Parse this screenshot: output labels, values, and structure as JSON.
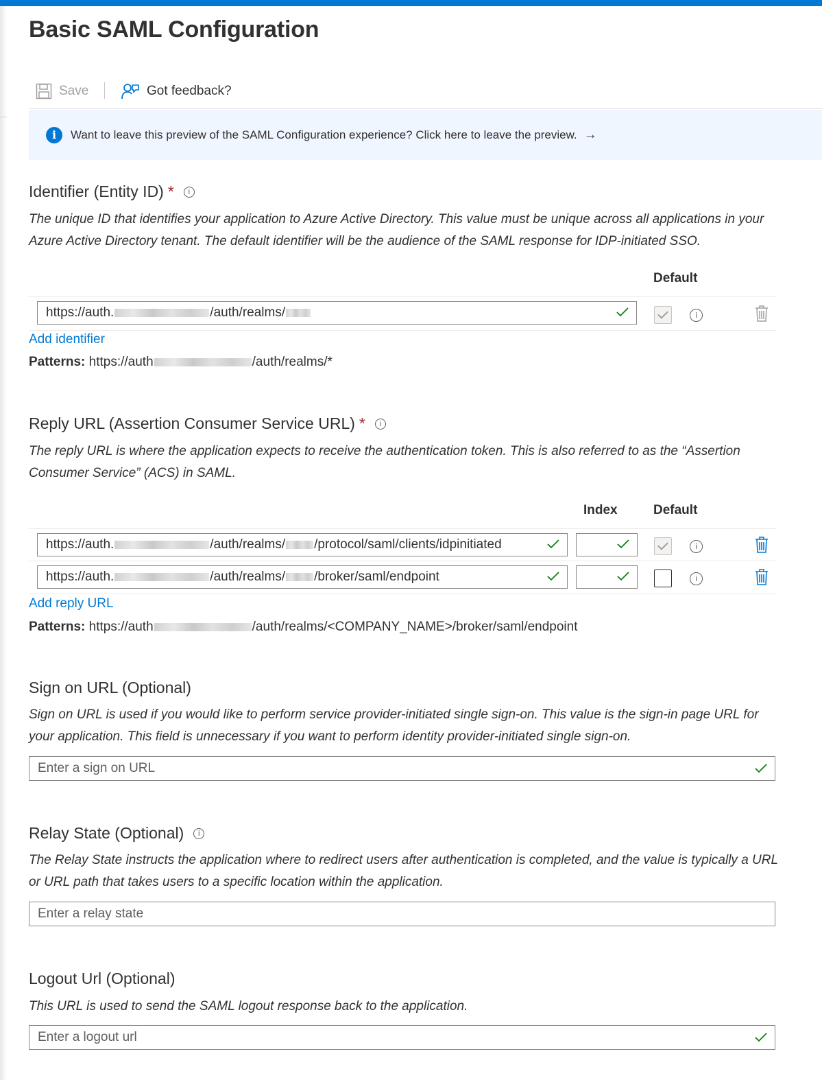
{
  "page": {
    "title": "Basic SAML Configuration"
  },
  "toolbar": {
    "save_label": "Save",
    "feedback_label": "Got feedback?"
  },
  "banner": {
    "text": "Want to leave this preview of the SAML Configuration experience? Click here to leave the preview.",
    "arrow": "→"
  },
  "identifier": {
    "heading": "Identifier (Entity ID)",
    "required_mark": "*",
    "description": "The unique ID that identifies your application to Azure Active Directory. This value must be unique across all applications in your Azure Active Directory tenant. The default identifier will be the audience of the SAML response for IDP-initiated SSO.",
    "col_default": "Default",
    "rows": [
      {
        "prefix": "https://auth.",
        "middle": "/auth/realms/",
        "suffix": "",
        "default_checked": true,
        "default_disabled": true
      }
    ],
    "add_link": "Add identifier",
    "patterns_label": "Patterns:",
    "patterns_prefix": "https://auth",
    "patterns_suffix": "/auth/realms/*"
  },
  "reply": {
    "heading": "Reply URL (Assertion Consumer Service URL)",
    "required_mark": "*",
    "description": "The reply URL is where the application expects to receive the authentication token. This is also referred to as the “Assertion Consumer Service” (ACS) in SAML.",
    "col_index": "Index",
    "col_default": "Default",
    "rows": [
      {
        "prefix": "https://auth.",
        "middle": "/auth/realms/",
        "suffix": "/protocol/saml/clients/idpinitiated",
        "index": "",
        "default_checked": true,
        "default_disabled": true
      },
      {
        "prefix": "https://auth.",
        "middle": "/auth/realms/",
        "suffix": "/broker/saml/endpoint",
        "index": "",
        "default_checked": false,
        "default_disabled": false
      }
    ],
    "add_link": "Add reply URL",
    "patterns_label": "Patterns:",
    "patterns_prefix": "https://auth",
    "patterns_suffix": "/auth/realms/<COMPANY_NAME>/broker/saml/endpoint"
  },
  "signon": {
    "heading": "Sign on URL (Optional)",
    "description": "Sign on URL is used if you would like to perform service provider-initiated single sign-on. This value is the sign-in page URL for your application. This field is unnecessary if you want to perform identity provider-initiated single sign-on.",
    "placeholder": "Enter a sign on URL"
  },
  "relay": {
    "heading": "Relay State (Optional)",
    "description": "The Relay State instructs the application where to redirect users after authentication is completed, and the value is typically a URL or URL path that takes users to a specific location within the application.",
    "placeholder": "Enter a relay state"
  },
  "logout": {
    "heading": "Logout Url (Optional)",
    "description": "This URL is used to send the SAML logout response back to the application.",
    "placeholder": "Enter a logout url"
  },
  "colors": {
    "accent": "#0078d4",
    "valid_check": "#107c10",
    "required": "#a4262c"
  }
}
